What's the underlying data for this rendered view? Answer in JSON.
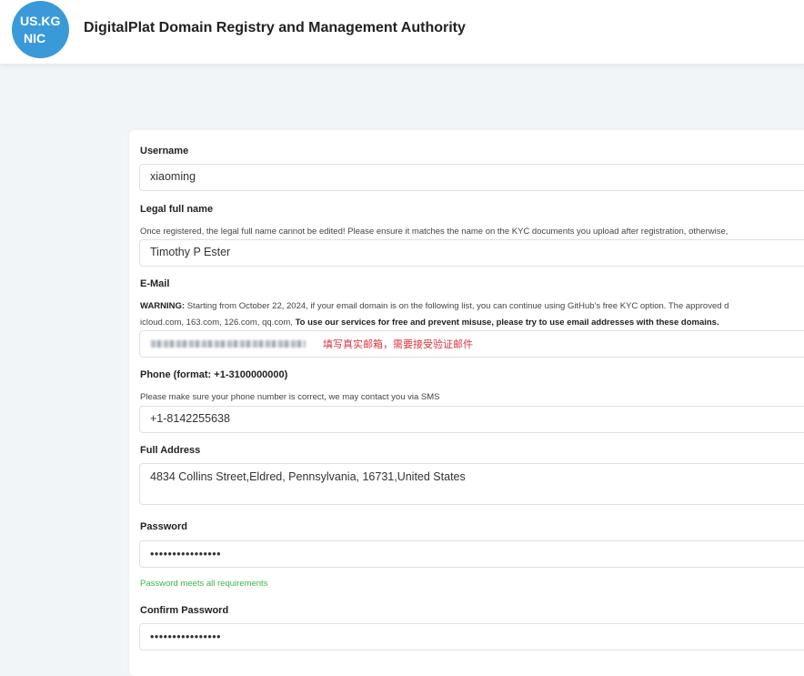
{
  "header": {
    "logo_line1": "US.KG",
    "logo_line2": "NIC",
    "title": "DigitalPlat Domain Registry and Management Authority"
  },
  "form": {
    "username": {
      "label": "Username",
      "value": "xiaoming"
    },
    "legal_name": {
      "label": "Legal full name",
      "help": "Once registered, the legal full name cannot be edited! Please ensure it matches the name on the KYC documents you upload after registration, otherwise,",
      "value": "Timothy P Ester"
    },
    "email": {
      "label": "E-Mail",
      "warning_prefix": "WARNING:",
      "warning_text": " Starting from October 22, 2024, if your email domain is on the following list, you can continue using GitHub's free KYC option. The approved d",
      "domains_text": "icloud.com, 163.com, 126.com, qq.com, ",
      "domains_bold": "To use our services for free and prevent misuse, please try to use email addresses with these domains.",
      "hint": "填写真实邮箱，需要接受验证邮件"
    },
    "phone": {
      "label": "Phone (format: +1-3100000000)",
      "help": "Please make sure your phone number is correct, we may contact you via SMS",
      "value": "+1-8142255638"
    },
    "address": {
      "label": "Full Address",
      "value": "4834 Collins Street,Eldred, Pennsylvania, 16731,United States"
    },
    "password": {
      "label": "Password",
      "value": "••••••••••••••••",
      "status": "Password meets all requirements"
    },
    "confirm_password": {
      "label": "Confirm Password",
      "value": "••••••••••••••••"
    }
  }
}
